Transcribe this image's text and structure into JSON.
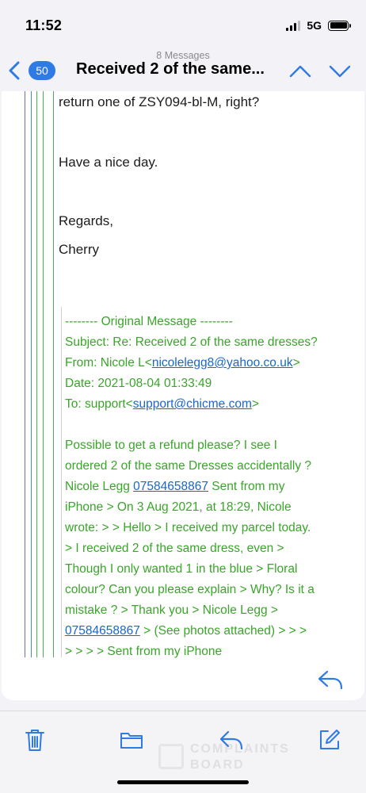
{
  "status": {
    "time": "11:52",
    "network": "5G"
  },
  "nav": {
    "back_count": "50",
    "subtitle": "8 Messages",
    "title": "Received 2 of the same..."
  },
  "message": {
    "lines": [
      "return one of  ZSY094-bl-M, right?",
      "Have a nice day.",
      "Regards,",
      "Cherry"
    ],
    "original": {
      "header": "-------- Original Message --------",
      "subject": "Subject: Re: Received 2 of the same dresses?",
      "from_label": "From: Nicole L<",
      "from_email": "nicolelegg8@yahoo.co.uk",
      "from_close": ">",
      "date": "Date: 2021-08-04 01:33:49",
      "to_label": "To: support<",
      "to_email": "support@chicme.com",
      "to_close": ">",
      "body": {
        "l1": "Possible to get a refund please? I see I",
        "l2": "ordered 2 of the same Dresses accidentally ?",
        "l3_pre": "Nicole Legg ",
        "phone": "07584658867",
        "l3_post": " Sent from my",
        "l4": "iPhone > On 3 Aug 2021, at 18:29, Nicole",
        "l5": "wrote: > > Hello > I received my parcel today.",
        "l6": "> I received 2 of the same dress, even >",
        "l7": "Though I only wanted 1 in the blue > Floral",
        "l8": "colour? Can you please explain > Why? Is it a",
        "l9": "mistake ? > Thank you > Nicole Legg >",
        "l10_post": " > (See photos attached) > > >",
        "l11": "> > > > Sent from my iPhone"
      }
    }
  },
  "watermark": {
    "line1": "COMPLAINTS",
    "line2": "BOARD"
  },
  "toolbar": {
    "icons": [
      "trash-icon",
      "folder-icon",
      "reply-icon",
      "compose-icon"
    ]
  },
  "colors": {
    "accent": "#2f7ae5",
    "quote_green": "#3aa52a",
    "link": "#1a66cc"
  }
}
